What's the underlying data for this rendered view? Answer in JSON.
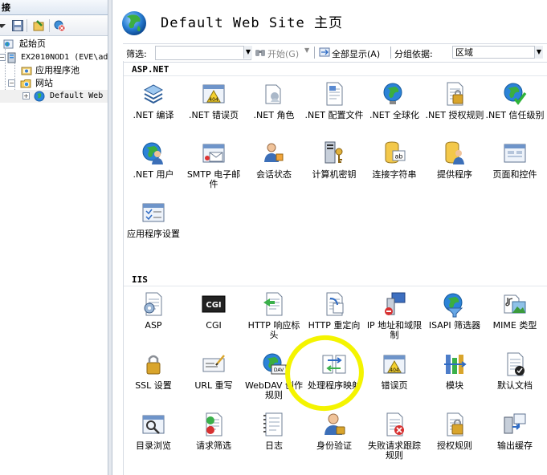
{
  "left": {
    "header": "接",
    "tree": [
      {
        "label": "起始页",
        "icon": "start-page-icon"
      },
      {
        "label": "EX2010NOD1 (EVE\\ad",
        "icon": "server-icon"
      },
      {
        "label": "应用程序池",
        "icon": "app-pool-icon"
      },
      {
        "label": "网站",
        "icon": "sites-folder-icon"
      },
      {
        "label": "Default Web",
        "icon": "website-globe-icon"
      }
    ]
  },
  "right": {
    "title": "Default Web Site 主页",
    "filter": {
      "label": "筛选:",
      "value": "",
      "go_label": "开始(G)",
      "show_all_label": "全部显示(A)",
      "group_label": "分组依据:",
      "group_value": "区域"
    },
    "sections": [
      {
        "title": "ASP.NET",
        "items": [
          {
            "label": ".NET 编译",
            "icon": "net-compilation-icon"
          },
          {
            "label": ".NET 错误页",
            "icon": "net-error-pages-icon"
          },
          {
            "label": ".NET 角色",
            "icon": "net-roles-icon"
          },
          {
            "label": ".NET 配置文件",
            "icon": "net-profile-icon"
          },
          {
            "label": ".NET 全球化",
            "icon": "net-globalization-icon"
          },
          {
            "label": ".NET 授权规则",
            "icon": "net-authorization-icon"
          },
          {
            "label": ".NET 信任级别",
            "icon": "net-trust-levels-icon"
          },
          {
            "label": ".NET 用户",
            "icon": "net-users-icon"
          },
          {
            "label": "SMTP 电子邮件",
            "icon": "smtp-email-icon"
          },
          {
            "label": "会话状态",
            "icon": "session-state-icon"
          },
          {
            "label": "计算机密钥",
            "icon": "machine-key-icon"
          },
          {
            "label": "连接字符串",
            "icon": "connection-strings-icon"
          },
          {
            "label": "提供程序",
            "icon": "providers-icon"
          },
          {
            "label": "页面和控件",
            "icon": "pages-controls-icon"
          },
          {
            "label": "应用程序设置",
            "icon": "app-settings-icon"
          }
        ]
      },
      {
        "title": "IIS",
        "items": [
          {
            "label": "ASP",
            "icon": "asp-icon"
          },
          {
            "label": "CGI",
            "icon": "cgi-icon"
          },
          {
            "label": "HTTP 响应标头",
            "icon": "http-response-headers-icon"
          },
          {
            "label": "HTTP 重定向",
            "icon": "http-redirect-icon"
          },
          {
            "label": "IP 地址和域限制",
            "icon": "ip-restrictions-icon"
          },
          {
            "label": "ISAPI 筛选器",
            "icon": "isapi-filters-icon"
          },
          {
            "label": "MIME 类型",
            "icon": "mime-types-icon"
          },
          {
            "label": "SSL 设置",
            "icon": "ssl-settings-icon"
          },
          {
            "label": "URL 重写",
            "icon": "url-rewrite-icon"
          },
          {
            "label": "WebDAV 创作规则",
            "icon": "webdav-icon"
          },
          {
            "label": "处理程序映射",
            "icon": "handler-mappings-icon"
          },
          {
            "label": "错误页",
            "icon": "error-pages-icon"
          },
          {
            "label": "模块",
            "icon": "modules-icon"
          },
          {
            "label": "默认文档",
            "icon": "default-document-icon"
          },
          {
            "label": "目录浏览",
            "icon": "directory-browsing-icon"
          },
          {
            "label": "请求筛选",
            "icon": "request-filtering-icon"
          },
          {
            "label": "日志",
            "icon": "logging-icon"
          },
          {
            "label": "身份验证",
            "icon": "authentication-icon"
          },
          {
            "label": "失败请求跟踪规则",
            "icon": "failed-request-tracing-icon"
          },
          {
            "label": "授权规则",
            "icon": "authorization-rules-icon"
          },
          {
            "label": "输出缓存",
            "icon": "output-caching-icon"
          }
        ]
      }
    ]
  }
}
